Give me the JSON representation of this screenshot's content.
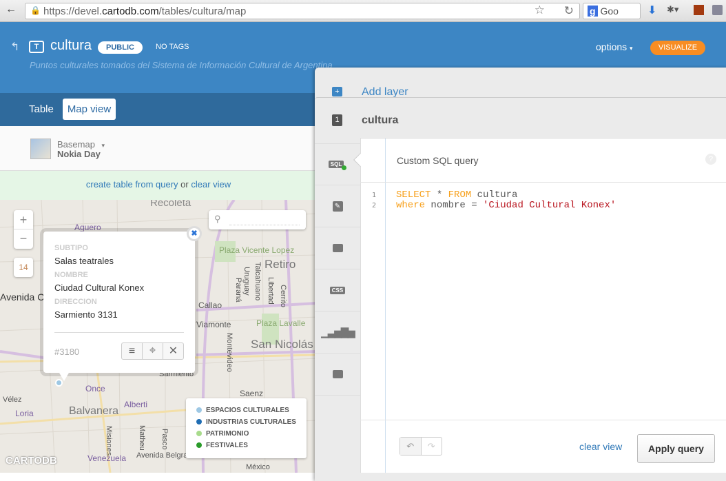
{
  "browser": {
    "url_prefix": "https://devel.",
    "url_domain": "cartodb.com",
    "url_path": "/tables/cultura/map",
    "search_placeholder": "Goo"
  },
  "header": {
    "title": "cultura",
    "table_icon": "T",
    "privacy": "PUBLIC",
    "tags": "NO TAGS",
    "description": "Puntos culturales tomados del Sistema de Información Cultural de Argentina",
    "options": "options",
    "visualize": "VISUALIZE"
  },
  "tabs": {
    "table": "Table",
    "map": "Map view"
  },
  "basemap": {
    "label": "Basemap",
    "value": "Nokia Day"
  },
  "notice": {
    "create": "create table from query",
    "or": " or ",
    "clear": "clear view"
  },
  "map": {
    "zoom_in": "+",
    "zoom_out": "−",
    "zoom_level": "14",
    "attribution": "CARTODB",
    "labels": [
      "Aguero",
      "Recoleta",
      "Plaza Vicente Lopez",
      "Retiro",
      "Avenida Cordoba",
      "Callao",
      "Viamonte",
      "Plaza Lavalle",
      "San Nicolás",
      "Once",
      "Balvanera",
      "Alberti",
      "Loria",
      "Vélez",
      "Saenz",
      "Sarmiento",
      "Venezuela",
      "México",
      "Misiones",
      "Matheu",
      "Pasco",
      "Avenida Belgrano",
      "Uruguay",
      "Talcahuano",
      "Libertad",
      "Cerrito",
      "Paraná",
      "Montevideo"
    ]
  },
  "popup": {
    "fields": [
      {
        "label": "SUBTIPO",
        "value": "Salas teatrales"
      },
      {
        "label": "NOMBRE",
        "value": "Ciudad Cultural Konex"
      },
      {
        "label": "DIRECCION",
        "value": "Sarmiento 3131"
      }
    ],
    "id": "#3180"
  },
  "legend": [
    {
      "label": "ESPACIOS CULTURALES",
      "color": "#9ec8e4"
    },
    {
      "label": "INDUSTRIAS CULTURALES",
      "color": "#1f6db3"
    },
    {
      "label": "PATRIMONIO",
      "color": "#a8db8c"
    },
    {
      "label": "FESTIVALES",
      "color": "#2a9b2a"
    }
  ],
  "panel": {
    "add_layer": "Add layer",
    "layer_number": "1",
    "layer_name": "cultura",
    "tools": [
      "SQL",
      "wizard",
      "infowindow",
      "CSS",
      "histogram",
      "legend"
    ],
    "editor": {
      "title": "Custom SQL query",
      "help": "?",
      "lines": [
        "1",
        "2"
      ],
      "code": {
        "l1_kw1": "SELECT",
        "l1_mid": " * ",
        "l1_kw2": "FROM",
        "l1_rest": " cultura",
        "l2_kw": "where",
        "l2_mid": " nombre = ",
        "l2_str": "'Ciudad Cultural Konex'"
      },
      "clear_view": "clear view",
      "apply": "Apply query"
    }
  }
}
